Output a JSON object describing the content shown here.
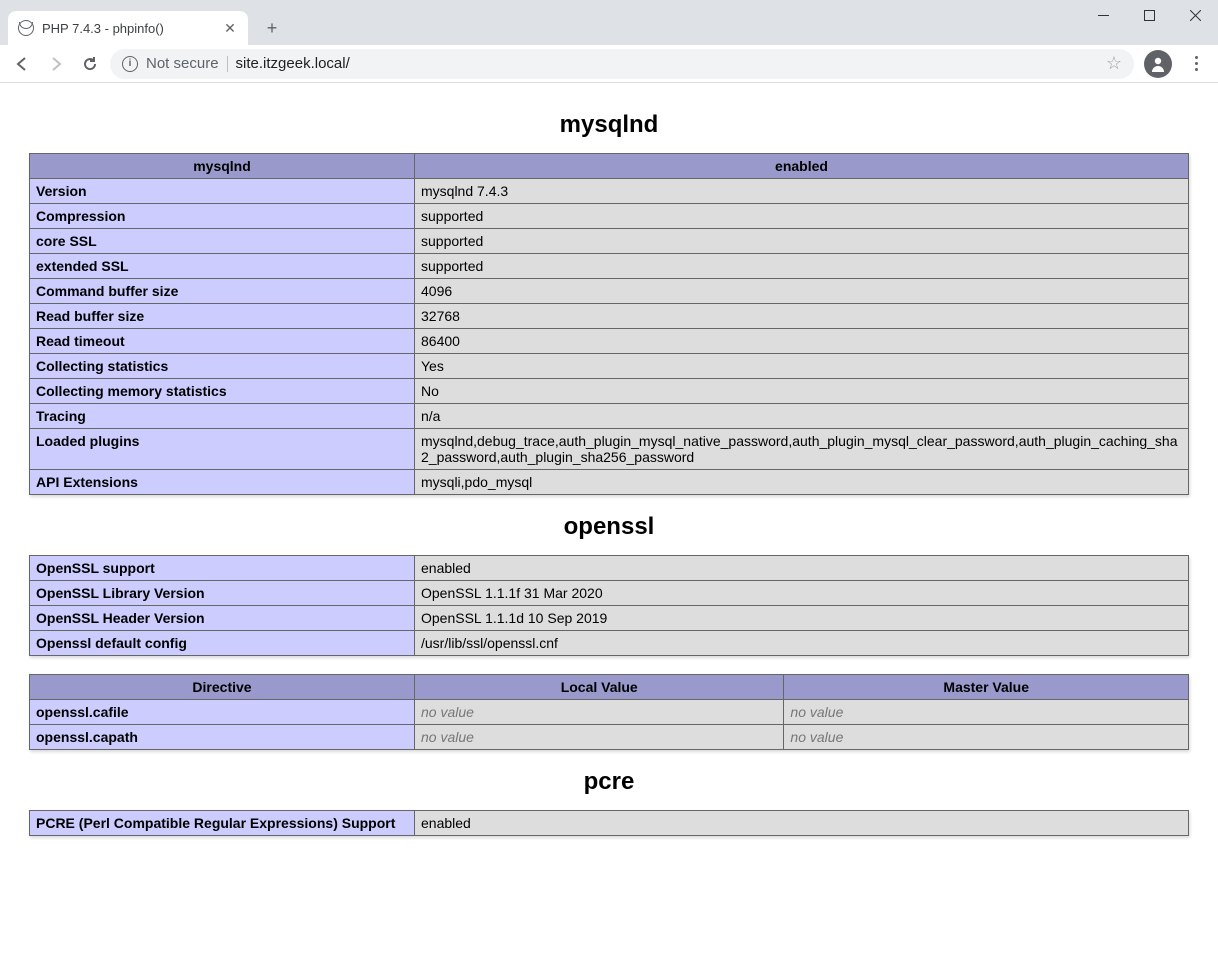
{
  "browser": {
    "tab_title": "PHP 7.4.3 - phpinfo()",
    "security_label": "Not secure",
    "url": "site.itzgeek.local/",
    "security_info_char": "i"
  },
  "sections": {
    "mysqlnd": {
      "title": "mysqlnd",
      "header_left": "mysqlnd",
      "header_right": "enabled",
      "rows": [
        {
          "k": "Version",
          "v": "mysqlnd 7.4.3"
        },
        {
          "k": "Compression",
          "v": "supported"
        },
        {
          "k": "core SSL",
          "v": "supported"
        },
        {
          "k": "extended SSL",
          "v": "supported"
        },
        {
          "k": "Command buffer size",
          "v": "4096"
        },
        {
          "k": "Read buffer size",
          "v": "32768"
        },
        {
          "k": "Read timeout",
          "v": "86400"
        },
        {
          "k": "Collecting statistics",
          "v": "Yes"
        },
        {
          "k": "Collecting memory statistics",
          "v": "No"
        },
        {
          "k": "Tracing",
          "v": "n/a"
        },
        {
          "k": "Loaded plugins",
          "v": "mysqlnd,debug_trace,auth_plugin_mysql_native_password,auth_plugin_mysql_clear_password,auth_plugin_caching_sha2_password,auth_plugin_sha256_password"
        },
        {
          "k": "API Extensions",
          "v": "mysqli,pdo_mysql"
        }
      ]
    },
    "openssl": {
      "title": "openssl",
      "rows": [
        {
          "k": "OpenSSL support",
          "v": "enabled"
        },
        {
          "k": "OpenSSL Library Version",
          "v": "OpenSSL 1.1.1f 31 Mar 2020"
        },
        {
          "k": "OpenSSL Header Version",
          "v": "OpenSSL 1.1.1d 10 Sep 2019"
        },
        {
          "k": "Openssl default config",
          "v": "/usr/lib/ssl/openssl.cnf"
        }
      ],
      "directives_header": {
        "d": "Directive",
        "l": "Local Value",
        "m": "Master Value"
      },
      "directives": [
        {
          "d": "openssl.cafile",
          "l": "no value",
          "m": "no value"
        },
        {
          "d": "openssl.capath",
          "l": "no value",
          "m": "no value"
        }
      ]
    },
    "pcre": {
      "title": "pcre",
      "rows": [
        {
          "k": "PCRE (Perl Compatible Regular Expressions) Support",
          "v": "enabled"
        }
      ]
    }
  }
}
